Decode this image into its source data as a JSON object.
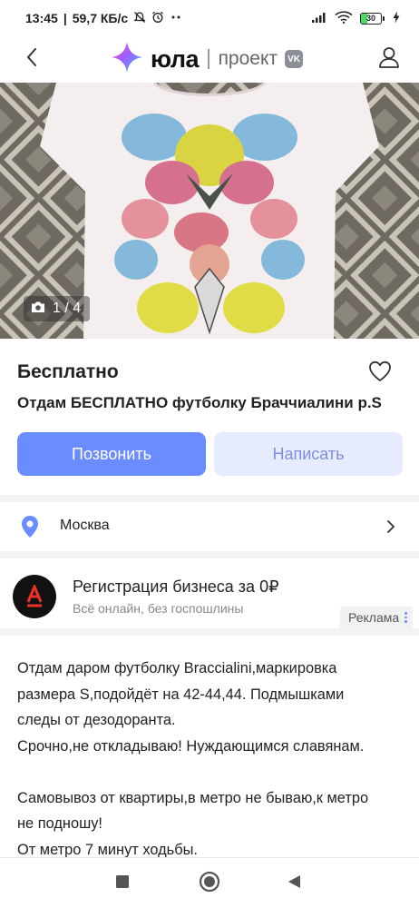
{
  "status_bar": {
    "time": "13:45",
    "network_speed": "59,7 КБ/с",
    "battery": "30",
    "battery_level": 0.3,
    "icons": [
      "mute-icon",
      "alarm-icon",
      "more-dots-icon",
      "signal-icon",
      "wifi-icon",
      "battery-icon"
    ]
  },
  "header": {
    "logo_name": "юла",
    "partner_text": "проект",
    "partner_badge": "VK"
  },
  "gallery": {
    "counter": "1 / 4"
  },
  "listing": {
    "price": "Бесплатно",
    "title": "Отдам БЕСПЛАТНО футболку Браччиалини р.S"
  },
  "actions": {
    "call_label": "Позвонить",
    "write_label": "Написать"
  },
  "location": {
    "city": "Москва"
  },
  "ad": {
    "title": "Регистрация бизнеса за 0₽",
    "subtitle": "Всё онлайн, без госпошлины",
    "label": "Реклама"
  },
  "description": {
    "lines": [
      "Отдам даром футболку Braccialini,маркировка",
      "размера S,подойдёт на 42-44,44. Подмышками",
      "следы от дезодоранта.",
      "Срочно,не откладываю! Нуждающимся славянам.",
      "",
      "Самовывоз от квартиры,в метро не бываю,к метро",
      "не подношу!",
      "От метро 7 минут ходьбы."
    ]
  },
  "colors": {
    "accent": "#6b8cff",
    "accent_light": "#e6ecfd",
    "location_pin": "#6b8cff"
  }
}
